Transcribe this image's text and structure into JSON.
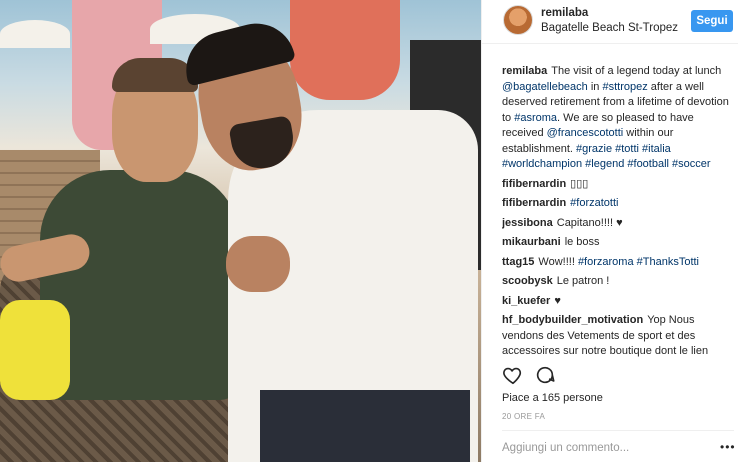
{
  "header": {
    "username": "remilaba",
    "location": "Bagatelle Beach St-Tropez",
    "follow_label": "Segui"
  },
  "caption": {
    "username": "remilaba",
    "parts": [
      {
        "t": "The visit of a legend today at lunch "
      },
      {
        "t": "@bagatellebeach",
        "link": true
      },
      {
        "t": " in "
      },
      {
        "t": "#sttropez",
        "link": true
      },
      {
        "t": " after a well deserved retirement from a lifetime of devotion to "
      },
      {
        "t": "#asroma",
        "link": true
      },
      {
        "t": ". We are so pleased to have received "
      },
      {
        "t": "@francescototti",
        "link": true
      },
      {
        "t": " within our establishment. "
      },
      {
        "t": "#grazie",
        "link": true
      },
      {
        "t": " "
      },
      {
        "t": "#totti",
        "link": true
      },
      {
        "t": " "
      },
      {
        "t": "#italia",
        "link": true
      },
      {
        "t": " "
      },
      {
        "t": "#worldchampion",
        "link": true
      },
      {
        "t": " "
      },
      {
        "t": "#legend",
        "link": true
      },
      {
        "t": " "
      },
      {
        "t": "#football",
        "link": true
      },
      {
        "t": " "
      },
      {
        "t": "#soccer",
        "link": true
      }
    ]
  },
  "comments": [
    {
      "user": "fifibernardin",
      "parts": [
        {
          "t": "▯▯▯"
        }
      ]
    },
    {
      "user": "fifibernardin",
      "parts": [
        {
          "t": "#forzatotti",
          "link": true
        }
      ]
    },
    {
      "user": "jessibona",
      "parts": [
        {
          "t": "Capitano!!!! ♥"
        }
      ]
    },
    {
      "user": "mikaurbani",
      "parts": [
        {
          "t": "le boss"
        }
      ]
    },
    {
      "user": "ttag15",
      "parts": [
        {
          "t": "Wow!!!! "
        },
        {
          "t": "#forzaroma",
          "link": true
        },
        {
          "t": " "
        },
        {
          "t": "#ThanksTotti",
          "link": true
        }
      ]
    },
    {
      "user": "scoobysk",
      "parts": [
        {
          "t": "Le patron !"
        }
      ]
    },
    {
      "user": "ki_kuefer",
      "parts": [
        {
          "t": "♥"
        }
      ]
    },
    {
      "user": "hf_bodybuilder_motivation",
      "parts": [
        {
          "t": "Yop Nous vendons des Vetements de sport et des accessoires sur notre boutique dont le lien"
        }
      ]
    }
  ],
  "actions": {
    "like_icon": "heart-outline-icon",
    "comment_icon": "comment-bubble-icon"
  },
  "likes_text": "Piace a 165 persone",
  "time_text": "20 ORE FA",
  "comment_input": {
    "placeholder": "Aggiungi un commento..."
  },
  "more_label": "•••",
  "colors": {
    "follow_button": "#3897f0",
    "link": "#003569",
    "muted": "#999999"
  }
}
